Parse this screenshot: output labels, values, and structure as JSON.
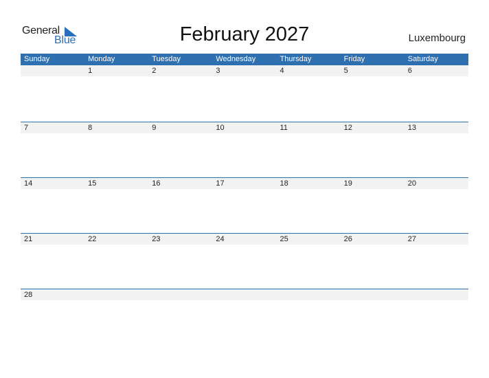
{
  "logo": {
    "word1": "General",
    "word2": "Blue",
    "accent_color": "#2a6fba"
  },
  "title": "February 2027",
  "country": "Luxembourg",
  "header_color": "#2e6fb0",
  "weekdays": [
    "Sunday",
    "Monday",
    "Tuesday",
    "Wednesday",
    "Thursday",
    "Friday",
    "Saturday"
  ],
  "weeks": [
    [
      "",
      "1",
      "2",
      "3",
      "4",
      "5",
      "6"
    ],
    [
      "7",
      "8",
      "9",
      "10",
      "11",
      "12",
      "13"
    ],
    [
      "14",
      "15",
      "16",
      "17",
      "18",
      "19",
      "20"
    ],
    [
      "21",
      "22",
      "23",
      "24",
      "25",
      "26",
      "27"
    ],
    [
      "28",
      "",
      "",
      "",
      "",
      "",
      ""
    ]
  ]
}
